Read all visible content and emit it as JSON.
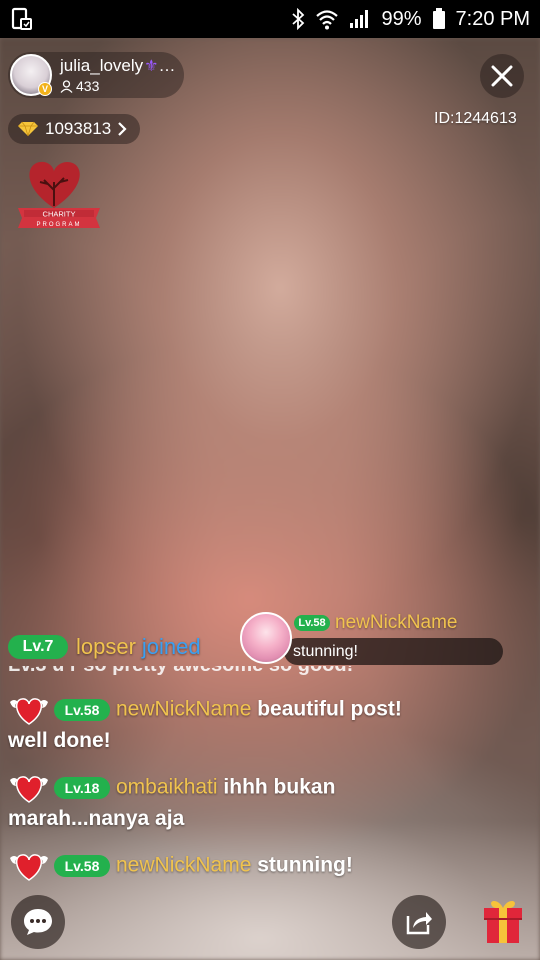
{
  "status_bar": {
    "battery": "99%",
    "time": "7:20 PM",
    "icons": [
      "screen-mirror-icon",
      "bluetooth-icon",
      "wifi-icon",
      "signal-icon",
      "battery-icon"
    ]
  },
  "host": {
    "name": "julia_lovely",
    "name_suffix": "…",
    "viewers": "433",
    "verified_badge": "V"
  },
  "diamonds": {
    "value": "1093813"
  },
  "room_id": "ID:1244613",
  "charity": {
    "line1": "CHARITY",
    "line2": "PROGRAM"
  },
  "joined": {
    "level": "Lv.7",
    "user": "lopser",
    "text": "joined"
  },
  "gift_popup": {
    "level": "Lv.58",
    "name": "newNickName",
    "message": "stunning!"
  },
  "chat_cut_text": "Lv.3 u r so pretty awesome so good!",
  "chat": [
    {
      "level": "Lv.58",
      "user": "newNickName",
      "message": "beautiful post! well done!"
    },
    {
      "level": "Lv.18",
      "user": "ombaikhati",
      "message": "ihhh bukan marah...nanya aja"
    },
    {
      "level": "Lv.58",
      "user": "newNickName",
      "message": "stunning!"
    }
  ],
  "colors": {
    "level_badge": "#23b14d",
    "username": "#f0c34e",
    "joined": "#3aa0f2",
    "gift_box": "#e0263a",
    "gift_ribbon": "#f6c33a"
  }
}
